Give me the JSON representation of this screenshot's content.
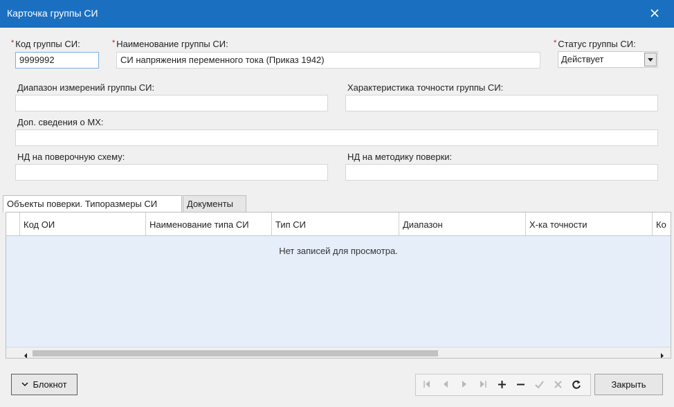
{
  "window": {
    "title": "Карточка группы СИ",
    "close_icon": "close-icon"
  },
  "form": {
    "code": {
      "label": "Код группы СИ:",
      "required_mark": "*",
      "value": "9999992"
    },
    "name": {
      "label": "Наименование группы СИ:",
      "required_mark": "*",
      "value": "СИ напряжения переменного тока (Приказ 1942)"
    },
    "status": {
      "label": "Статус группы СИ:",
      "required_mark": "*",
      "value": "Действует"
    },
    "range": {
      "label": "Диапазон измерений группы СИ:",
      "value": ""
    },
    "accuracy": {
      "label": "Характеристика точности группы СИ:",
      "value": ""
    },
    "extra": {
      "label": "Доп. сведения о МХ:",
      "value": ""
    },
    "nd_scheme": {
      "label": "НД на поверочную схему:",
      "value": ""
    },
    "nd_method": {
      "label": "НД на методику поверки:",
      "value": ""
    }
  },
  "tabs": [
    {
      "label": "Объекты поверки. Типоразмеры СИ",
      "active": true
    },
    {
      "label": "Документы",
      "active": false
    }
  ],
  "grid": {
    "columns": [
      "Код ОИ",
      "Наименование типа СИ",
      "Тип СИ",
      "Диапазон",
      "Х-ка точности",
      "Ко"
    ],
    "empty_text": "Нет записей для просмотра."
  },
  "footer": {
    "notepad_label": "Блокнот",
    "close_label": "Закрыть"
  },
  "colors": {
    "title_bar": "#1a6fc0",
    "grid_body": "#e6eefa",
    "required": "#d01010"
  }
}
